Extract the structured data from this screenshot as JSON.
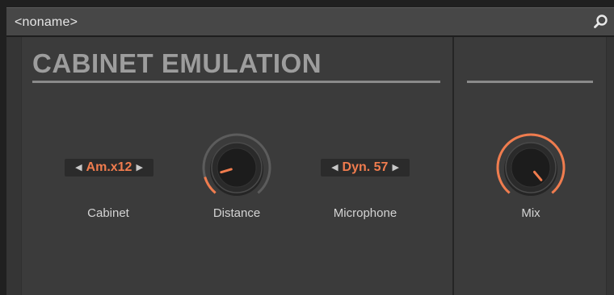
{
  "header": {
    "preset_name": "<noname>",
    "search_icon": "search-icon"
  },
  "section": {
    "title": "CABINET EMULATION"
  },
  "controls": {
    "cabinet": {
      "value": "Am.x12",
      "label": "Cabinet"
    },
    "distance": {
      "label": "Distance",
      "level": 0.12
    },
    "microphone": {
      "value": "Dyn. 57",
      "label": "Microphone"
    },
    "mix": {
      "label": "Mix",
      "level": 1.0
    }
  },
  "colors": {
    "accent": "#f07c4e",
    "panel": "#3b3b3b",
    "topbar": "#474747",
    "label": "#d4d4d4"
  }
}
